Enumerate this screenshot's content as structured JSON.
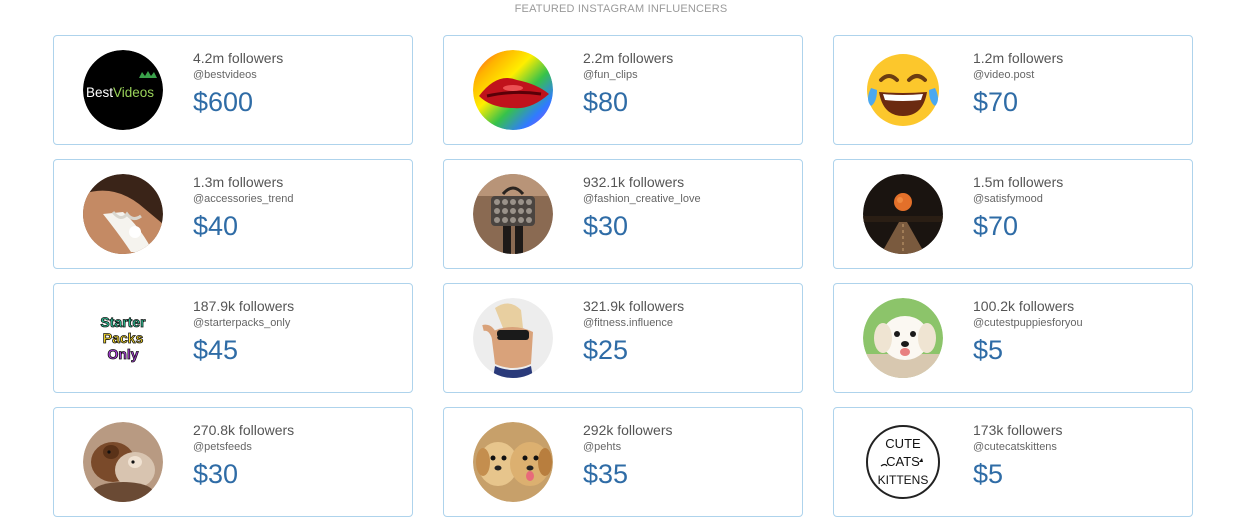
{
  "section_title": "FEATURED INSTAGRAM INFLUENCERS",
  "accent_color": "#2f6ca6",
  "border_color": "#aed3ec",
  "influencers": [
    {
      "followers": "4.2m followers",
      "handle": "@bestvideos",
      "price": "$600",
      "avatar": "best-videos-logo",
      "logo_text": [
        "Best",
        "Videos"
      ]
    },
    {
      "followers": "2.2m followers",
      "handle": "@fun_clips",
      "price": "$80",
      "avatar": "rainbow-lips-photo"
    },
    {
      "followers": "1.2m followers",
      "handle": "@video.post",
      "price": "$70",
      "avatar": "laughing-emoji"
    },
    {
      "followers": "1.3m followers",
      "handle": "@accessories_trend",
      "price": "$40",
      "avatar": "fashion-collar-photo"
    },
    {
      "followers": "932.1k followers",
      "handle": "@fashion_creative_love",
      "price": "$30",
      "avatar": "studded-bag-photo"
    },
    {
      "followers": "1.5m followers",
      "handle": "@satisfymood",
      "price": "$70",
      "avatar": "moon-road-photo"
    },
    {
      "followers": "187.9k followers",
      "handle": "@starterpacks_only",
      "price": "$45",
      "avatar": "starter-packs-logo",
      "logo_text": [
        "Starter",
        "Packs",
        "Only"
      ]
    },
    {
      "followers": "321.9k followers",
      "handle": "@fitness.influence",
      "price": "$25",
      "avatar": "fitness-photo"
    },
    {
      "followers": "100.2k followers",
      "handle": "@cutestpuppiesforyou",
      "price": "$5",
      "avatar": "white-puppy-photo"
    },
    {
      "followers": "270.8k followers",
      "handle": "@petsfeeds",
      "price": "$30",
      "avatar": "pets-photo"
    },
    {
      "followers": "292k followers",
      "handle": "@pehts",
      "price": "$35",
      "avatar": "golden-puppies-photo"
    },
    {
      "followers": "173k followers",
      "handle": "@cutecatskittens",
      "price": "$5",
      "avatar": "cute-cats-kittens-logo",
      "logo_text": [
        "CUTE",
        "CATS",
        "KITTENS"
      ]
    }
  ]
}
